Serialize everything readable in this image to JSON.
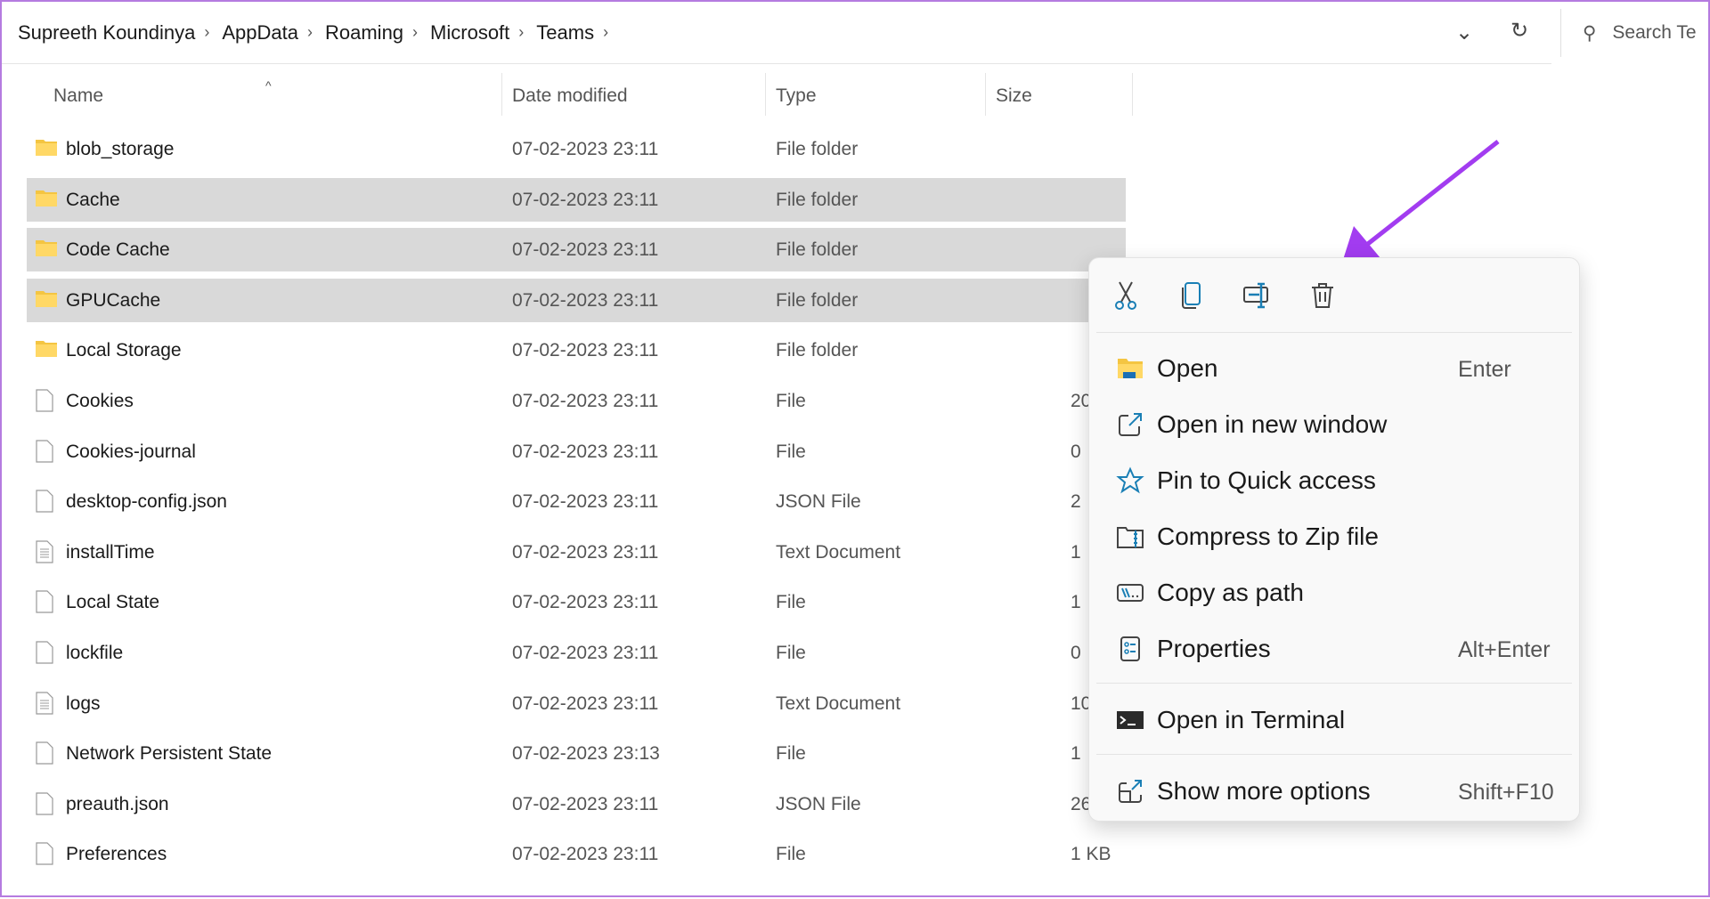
{
  "breadcrumb": [
    "Supreeth Koundinya",
    "AppData",
    "Roaming",
    "Microsoft",
    "Teams"
  ],
  "search_placeholder": "Search Te",
  "columns": {
    "name": "Name",
    "date": "Date modified",
    "type": "Type",
    "size": "Size"
  },
  "files": [
    {
      "name": "blob_storage",
      "date": "07-02-2023 23:11",
      "type": "File folder",
      "size": "",
      "icon": "folder",
      "selected": false
    },
    {
      "name": "Cache",
      "date": "07-02-2023 23:11",
      "type": "File folder",
      "size": "",
      "icon": "folder",
      "selected": true
    },
    {
      "name": "Code Cache",
      "date": "07-02-2023 23:11",
      "type": "File folder",
      "size": "",
      "icon": "folder",
      "selected": true
    },
    {
      "name": "GPUCache",
      "date": "07-02-2023 23:11",
      "type": "File folder",
      "size": "",
      "icon": "folder",
      "selected": true
    },
    {
      "name": "Local Storage",
      "date": "07-02-2023 23:11",
      "type": "File folder",
      "size": "",
      "icon": "folder",
      "selected": false
    },
    {
      "name": "Cookies",
      "date": "07-02-2023 23:11",
      "type": "File",
      "size": "20",
      "icon": "file",
      "selected": false
    },
    {
      "name": "Cookies-journal",
      "date": "07-02-2023 23:11",
      "type": "File",
      "size": "0",
      "icon": "file",
      "selected": false
    },
    {
      "name": "desktop-config.json",
      "date": "07-02-2023 23:11",
      "type": "JSON File",
      "size": "2",
      "icon": "file",
      "selected": false
    },
    {
      "name": "installTime",
      "date": "07-02-2023 23:11",
      "type": "Text Document",
      "size": "1",
      "icon": "text",
      "selected": false
    },
    {
      "name": "Local State",
      "date": "07-02-2023 23:11",
      "type": "File",
      "size": "1",
      "icon": "file",
      "selected": false
    },
    {
      "name": "lockfile",
      "date": "07-02-2023 23:11",
      "type": "File",
      "size": "0",
      "icon": "file",
      "selected": false
    },
    {
      "name": "logs",
      "date": "07-02-2023 23:11",
      "type": "Text Document",
      "size": "10",
      "icon": "text",
      "selected": false
    },
    {
      "name": "Network Persistent State",
      "date": "07-02-2023 23:13",
      "type": "File",
      "size": "1",
      "icon": "file",
      "selected": false
    },
    {
      "name": "preauth.json",
      "date": "07-02-2023 23:11",
      "type": "JSON File",
      "size": "26",
      "icon": "file",
      "selected": false
    },
    {
      "name": "Preferences",
      "date": "07-02-2023 23:11",
      "type": "File",
      "size": "1 KB",
      "icon": "file",
      "selected": false
    }
  ],
  "context_menu": {
    "toolbar": [
      "cut-icon",
      "copy-icon",
      "rename-icon",
      "delete-icon"
    ],
    "items": [
      {
        "label": "Open",
        "shortcut": "Enter",
        "icon": "folder-open-icon"
      },
      {
        "label": "Open in new window",
        "shortcut": "",
        "icon": "open-new-window-icon"
      },
      {
        "label": "Pin to Quick access",
        "shortcut": "",
        "icon": "star-icon"
      },
      {
        "label": "Compress to Zip file",
        "shortcut": "",
        "icon": "zip-icon"
      },
      {
        "label": "Copy as path",
        "shortcut": "",
        "icon": "copy-path-icon"
      },
      {
        "label": "Properties",
        "shortcut": "Alt+Enter",
        "icon": "properties-icon"
      },
      {
        "label": "Open in Terminal",
        "shortcut": "",
        "icon": "terminal-icon"
      },
      {
        "label": "Show more options",
        "shortcut": "Shift+F10",
        "icon": "show-more-icon"
      }
    ]
  },
  "colors": {
    "accent_arrow": "#a23cf0",
    "selection": "#d9d9d9",
    "icon_blue": "#1a7fb5"
  }
}
